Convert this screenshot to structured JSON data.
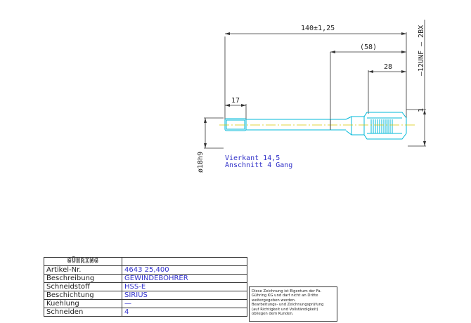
{
  "dimensions": {
    "overall_length": "140±1,25",
    "mid_length": "(58)",
    "thread_length": "28",
    "square_length": "17",
    "shank_diameter": "ø18h9",
    "thread_spec": "—12UNF — 2BX",
    "edge_mark": "1"
  },
  "notes": {
    "line1": "Vierkant 14,5",
    "line2": "Anschnitt 4 Gang"
  },
  "title_block": {
    "logo": "GÜHRING",
    "rows": [
      {
        "label": "Artikel-Nr.",
        "value": "4643 25,400"
      },
      {
        "label": "Beschreibung",
        "value": "GEWINDEBOHRER"
      },
      {
        "label": "Schneidstoff",
        "value": "HSS-E"
      },
      {
        "label": "Beschichtung",
        "value": "SIRIUS"
      },
      {
        "label": "Kuehlung",
        "value": "—"
      },
      {
        "label": "Schneiden",
        "value": "4"
      }
    ]
  },
  "notice": {
    "lines": [
      "Diese Zeichnung ist Eigentum der Fa.",
      "Gühring KG und darf nicht an Dritte",
      "weitergegeben werden.",
      "Bearbeitungs- und Zeichnungsprüfung",
      "(auf Richtigkeit und Vollständigkeit)",
      "obliegen dem Kunden."
    ]
  },
  "colors": {
    "outline": "#00b8d8",
    "center_line": "#d8c800",
    "dimension_line": "#222222",
    "note_text": "#3030c8"
  }
}
